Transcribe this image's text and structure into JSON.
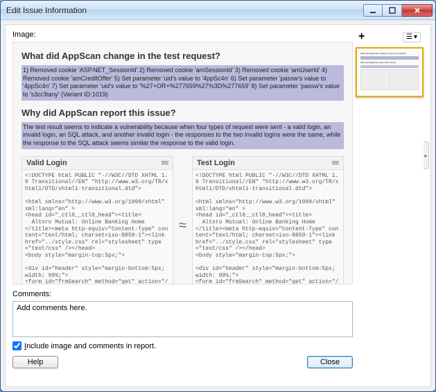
{
  "window": {
    "title": "Edit Issue Information"
  },
  "labels": {
    "image": "Image:",
    "comments": "Comments:"
  },
  "report": {
    "q1": "What did AppScan change in the test request?",
    "a1": "1) Removed cookie 'ASP.NET_SessionId' 2) Removed cookie 'amSessionId' 3) Removed cookie 'amUserId' 4) Removed cookie 'amCreditOffer' 5) Set parameter 'uid's value to '4ppSc4n' 6) Set parameter 'passw's value to '4ppSc4n' 7) Set parameter 'uid's value to '%27+OR+%277659%27%3D%277659' 8) Set parameter 'passw's value to 's3cr3tany' (Variant ID:1019)",
    "q2": "Why did AppScan report this issue?",
    "a2": "The test result seems to indicate a vulnerability because when four types of request were sent - a valid login, an invalid login, an SQL attack, and another invalid login - the responses to the two invalid logins were the same, while the response to the SQL attack seems similar the response to the valid login.",
    "col1_title": "Valid Login",
    "col2_title": "Test Login",
    "code1": "<!DOCTYPE html PUBLIC \"-//W3C//DTD XHTML 1.0 Transitional//EN\" \"http://www.w3.org/TR/xhtml1/DTD/xhtml1-transitional.dtd\">\n\n<html xmlns=\"http://www.w3.org/1999/xhtml\" xml:lang=\"en\" >\n<head id=\"_ctl0__ctl0_head\"><title>\n  Altoro Mutual: Online Banking Home\n</title><meta http-equiv=\"Content-Type\" content=\"text/html; charset=iso-8859-1\"><link href=\"../style.css\" rel=\"stylesheet\" type=\"text/css\" /></head>\n<body style=\"margin-top:5px;\">\n\n<div id=\"header\" style=\"margin-bottom:5px; width: 99%;\">\n<form id=\"frmSearch\" method=\"get\" action=\"/search.aspx\">",
    "code2": "<!DOCTYPE html PUBLIC \"-//W3C//DTD XHTML 1.0 Transitional//EN\" \"http://www.w3.org/TR/xhtml1/DTD/xhtml1-transitional.dtd\">\n\n<html xmlns=\"http://www.w3.org/1999/xhtml\" xml:lang=\"en\" >\n<head id=\"_ctl0__ctl0_head\"><title>\n  Altoro Mutual: Online Banking Home\n</title><meta http-equiv=\"Content-Type\" content=\"text/html; charset=iso-8859-1\"><link href=\"../style.css\" rel=\"stylesheet\" type=\"text/css\" /></head>\n<body style=\"margin-top:5px;\">\n\n<div id=\"header\" style=\"margin-bottom:5px; width: 99%;\">\n<form id=\"frmSearch\" method=\"get\" action=\"/search.aspx\">"
  },
  "comments": {
    "value": "Add comments here."
  },
  "checkbox": {
    "label": "Include image and comments in report."
  },
  "buttons": {
    "help": "Help",
    "close": "Close"
  }
}
